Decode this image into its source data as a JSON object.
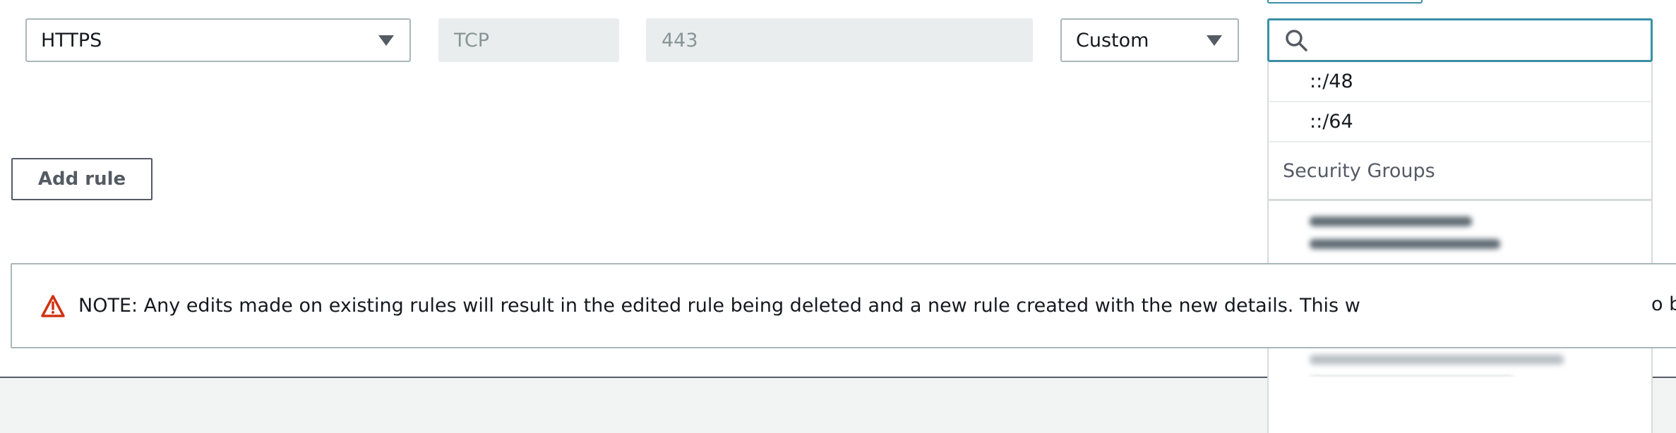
{
  "rule_row": {
    "type_select": {
      "value": "HTTPS"
    },
    "protocol": {
      "value": "TCP"
    },
    "port_range": {
      "value": "443"
    },
    "source_select": {
      "value": "Custom"
    },
    "source_search": {
      "value": "",
      "placeholder": ""
    }
  },
  "source_dropdown": {
    "options": [
      "::/48",
      "::/64"
    ],
    "group_label": "Security Groups"
  },
  "add_rule_button": {
    "label": "Add rule"
  },
  "note": {
    "text": "NOTE: Any edits made on existing rules will result in the edited rule being deleted and a new rule created with the new details. This w",
    "tail": "o b"
  },
  "colors": {
    "focus_border": "#3a8fa6",
    "warning_red": "#d13212",
    "text": "#16191f"
  }
}
